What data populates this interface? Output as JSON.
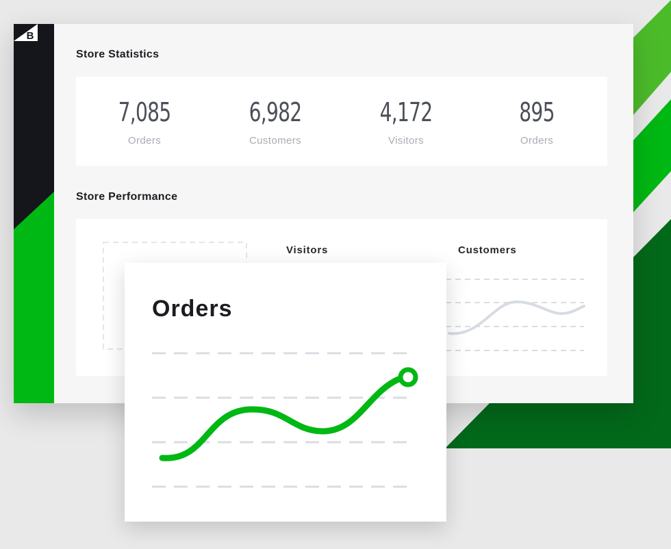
{
  "colors": {
    "brand_dark": "#15151c",
    "brand_green": "#00b813",
    "stripe_light_green": "#4cbb2a",
    "stripe_dark_green": "#03691a",
    "panel_bg": "#f6f6f7",
    "card_bg": "#ffffff",
    "gridline": "#d9dde3",
    "customers_line": "#d7dce2"
  },
  "sidebar": {
    "logo_icon": "bigcommerce-b-logo-icon",
    "logo_letter": "B"
  },
  "store_statistics": {
    "title": "Store Statistics",
    "items": [
      {
        "value": "7,085",
        "label": "Orders"
      },
      {
        "value": "6,982",
        "label": "Customers"
      },
      {
        "value": "4,172",
        "label": "Visitors"
      },
      {
        "value": "895",
        "label": "Orders"
      }
    ]
  },
  "store_performance": {
    "title": "Store Performance",
    "visitors_title": "Visitors",
    "customers_title": "Customers"
  },
  "orders_widget": {
    "title": "Orders",
    "end_marker_icon": "circle-marker-icon"
  }
}
